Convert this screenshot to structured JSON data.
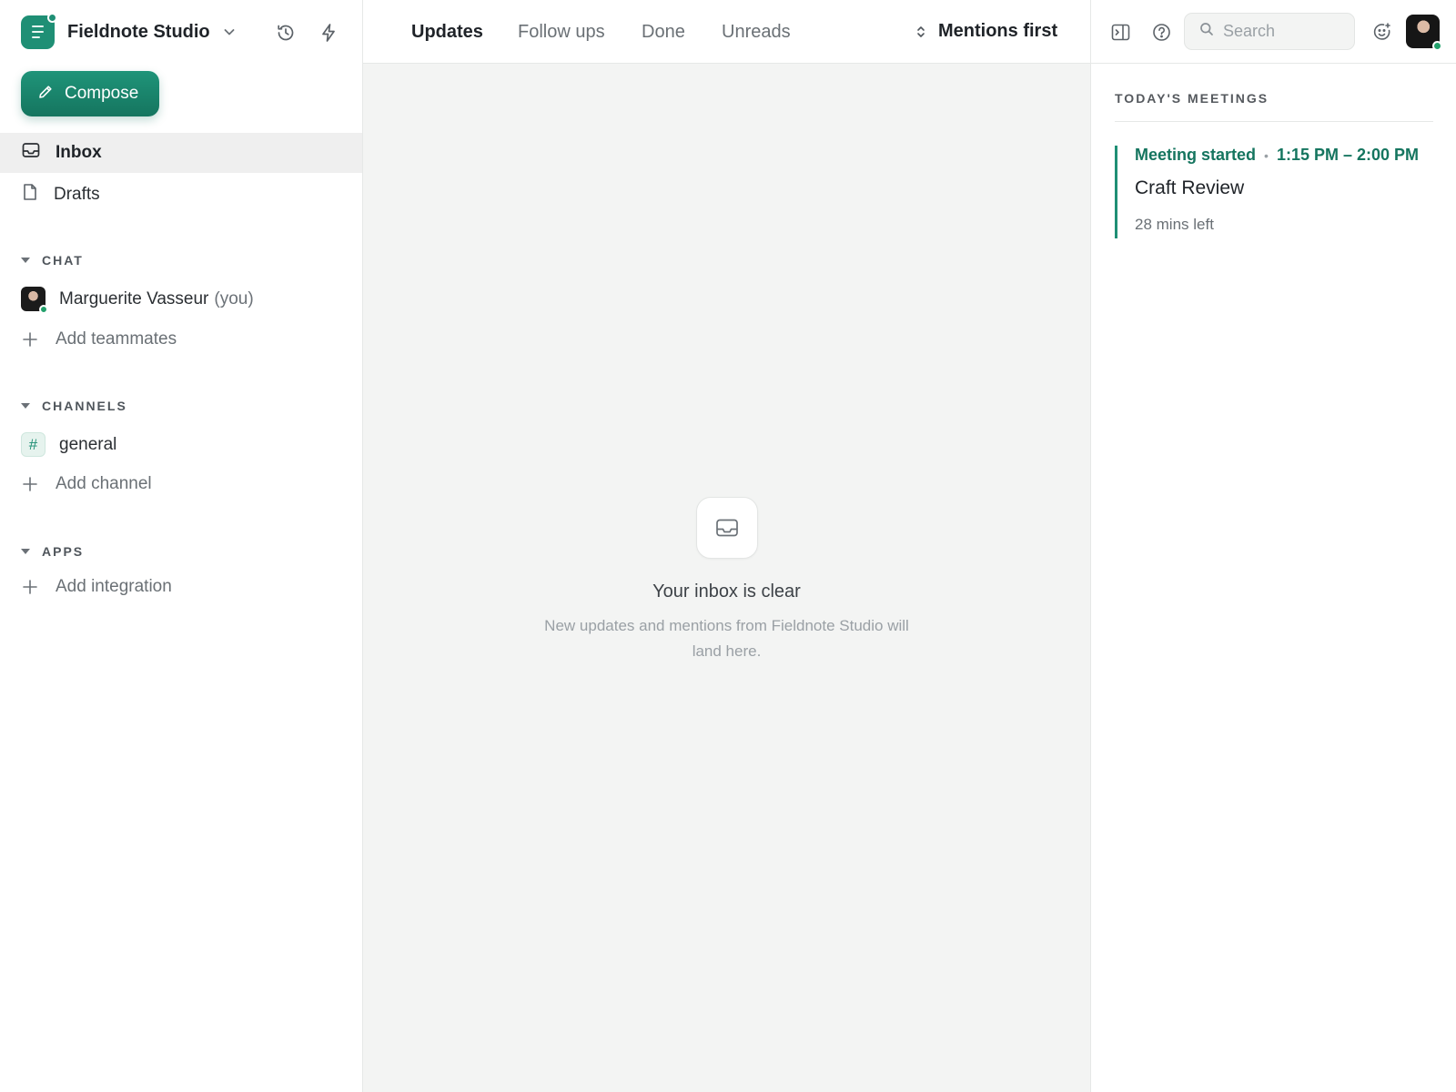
{
  "workspace": {
    "name": "Fieldnote Studio"
  },
  "compose": {
    "label": "Compose"
  },
  "nav": [
    {
      "label": "Inbox",
      "active": true
    },
    {
      "label": "Drafts",
      "active": false
    }
  ],
  "chat": {
    "heading": "CHAT",
    "user_name": "Marguerite Vasseur",
    "user_suffix": "(you)",
    "add_label": "Add teammates"
  },
  "channels": {
    "heading": "CHANNELS",
    "items": [
      {
        "label": "general"
      }
    ],
    "add_label": "Add channel"
  },
  "apps": {
    "heading": "APPS",
    "add_label": "Add integration"
  },
  "tabs": [
    {
      "label": "Updates",
      "active": true
    },
    {
      "label": "Follow ups",
      "active": false
    },
    {
      "label": "Done",
      "active": false
    },
    {
      "label": "Unreads",
      "active": false
    }
  ],
  "sort": {
    "label": "Mentions first"
  },
  "empty_state": {
    "title": "Your inbox is clear",
    "subtitle": "New updates and mentions from Fieldnote Studio will land here."
  },
  "search": {
    "placeholder": "Search"
  },
  "meetings": {
    "heading": "TODAY'S MEETINGS",
    "items": [
      {
        "status": "Meeting started",
        "time": "1:15 PM – 2:00 PM",
        "title": "Craft Review",
        "remaining": "28 mins left"
      }
    ]
  },
  "colors": {
    "accent": "#1f8f75",
    "accent_dark": "#15755f",
    "online": "#22a06b"
  },
  "icons": {
    "history": "history-icon",
    "bolt": "bolt-icon",
    "panel": "panel-toggle-icon",
    "help": "help-icon",
    "emoji": "emoji-add-icon"
  }
}
